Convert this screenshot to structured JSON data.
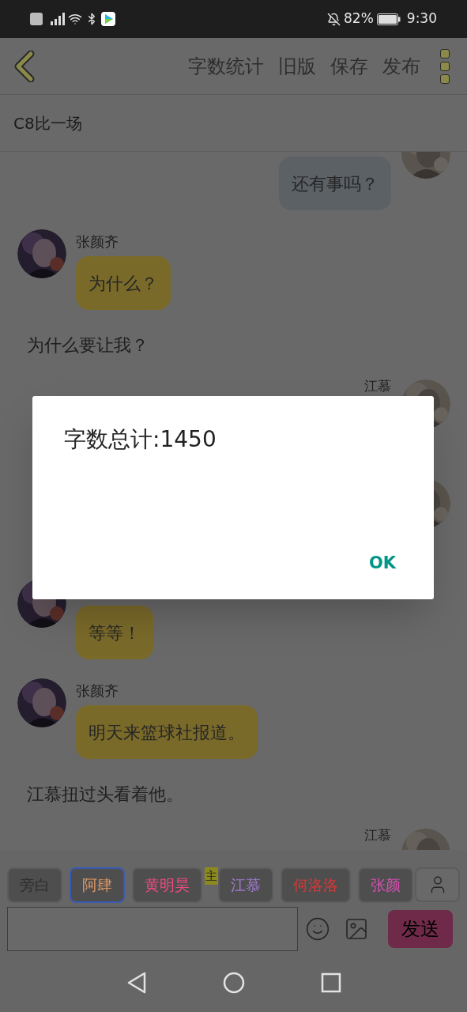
{
  "status_bar": {
    "battery": "82%",
    "time": "9:30"
  },
  "toolbar": {
    "actions": [
      "字数统计",
      "旧版",
      "保存",
      "发布"
    ]
  },
  "title": "C8比一场",
  "messages": [
    {
      "kind": "outgoing",
      "text": "还有事吗？"
    },
    {
      "kind": "incoming",
      "name": "张颜齐",
      "text": "为什么？"
    },
    {
      "kind": "narration",
      "text": "为什么要让我？"
    },
    {
      "kind": "outgoing",
      "name": "江慕"
    },
    {
      "kind": "outgoing"
    },
    {
      "kind": "incoming",
      "text": "等等！"
    },
    {
      "kind": "incoming",
      "name": "张颜齐",
      "text": "明天来篮球社报道。"
    },
    {
      "kind": "narration",
      "text": "江慕扭过头看着他。"
    },
    {
      "kind": "outgoing",
      "name": "江慕"
    }
  ],
  "characters": [
    {
      "label": "旁白",
      "color": "#2e2e2e",
      "selected": false
    },
    {
      "label": "阿肆",
      "color": "#e09a68",
      "selected": true
    },
    {
      "label": "黄明昊",
      "color": "#f04a80",
      "selected": false
    },
    {
      "label": "江慕",
      "color": "#a07ad0",
      "selected": false,
      "badge": "主"
    },
    {
      "label": "何洛洛",
      "color": "#d83838",
      "selected": false
    },
    {
      "label": "张颜",
      "color": "#d850b4",
      "selected": false
    }
  ],
  "composer": {
    "send": "发送"
  },
  "dialog": {
    "message": "字数总计:1450",
    "button": "OK"
  }
}
